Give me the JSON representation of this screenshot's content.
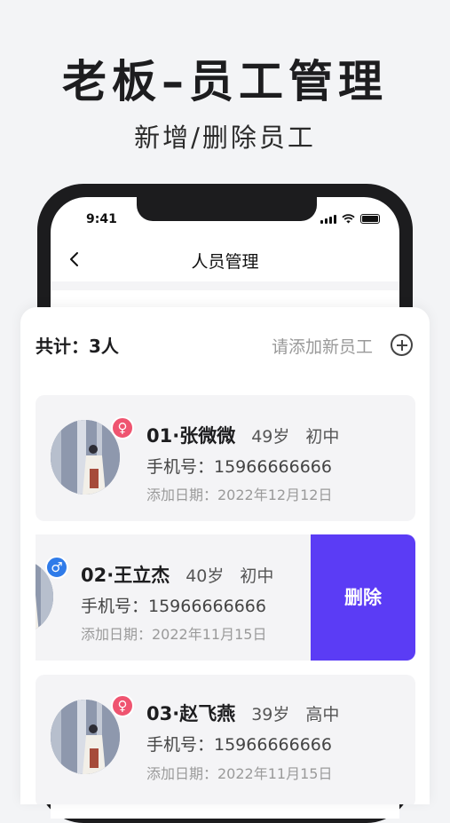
{
  "promo": {
    "title": "老板–员工管理",
    "subtitle": "新增/删除员工"
  },
  "status_bar": {
    "time": "9:41",
    "icons": [
      "signal-icon",
      "wifi-icon",
      "battery-icon"
    ]
  },
  "nav": {
    "back_icon": "chevron-left-icon",
    "title": "人员管理"
  },
  "summary": {
    "count_label": "共计：3人",
    "add_text": "请添加新员工",
    "add_icon": "plus-circle-icon"
  },
  "employees": [
    {
      "name": "01·张微微",
      "age": "49岁",
      "education": "初中",
      "gender": "female",
      "gender_symbol": "♀",
      "phone": "手机号：15966666666",
      "date": "添加日期：2022年12月12日"
    },
    {
      "name": "02·王立杰",
      "age": "40岁",
      "education": "初中",
      "gender": "male",
      "gender_symbol": "♂",
      "phone": "手机号：15966666666",
      "date": "添加日期：2022年11月15日",
      "swiped": true
    },
    {
      "name": "03·赵飞燕",
      "age": "39岁",
      "education": "高中",
      "gender": "female",
      "gender_symbol": "♀",
      "phone": "手机号：15966666666",
      "date": "添加日期：2022年11月15日"
    }
  ],
  "actions": {
    "delete_label": "删除"
  },
  "colors": {
    "delete_bg": "#5b3cf5",
    "female_badge": "#ef5470",
    "male_badge": "#2f7be9",
    "card_bg": "#f4f4f6"
  }
}
